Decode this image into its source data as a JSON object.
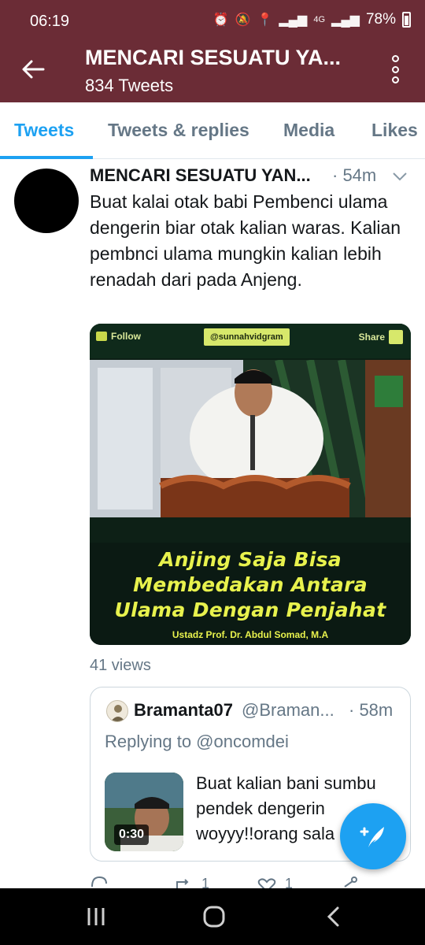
{
  "status_bar": {
    "time": "06:19",
    "network": "4G",
    "battery": "78%"
  },
  "header": {
    "title": "MENCARI SESUATU YA...",
    "tweet_count": "834 Tweets"
  },
  "tabs": [
    {
      "label": "Tweets",
      "active": true
    },
    {
      "label": "Tweets & replies",
      "active": false
    },
    {
      "label": "Media",
      "active": false
    },
    {
      "label": "Likes",
      "active": false
    }
  ],
  "tweet": {
    "name": "MENCARI SESUATU YAN...",
    "time": "· 54m",
    "text": "Buat kalai otak babi Pembenci ulama dengerin  biar otak kalian waras. Kalian pembnci ulama mungkin kalian lebih renadah dari pada Anjeng.",
    "views": "41 views",
    "media": {
      "follow_label": "Follow",
      "handle": "@sunnahvidgram",
      "share_label": "Share",
      "caption_lines": [
        "Anjing Saja Bisa",
        "Membedakan Antara",
        "Ulama Dengan Penjahat"
      ],
      "credit": "Ustadz  Prof. Dr. Abdul Somad, M.A"
    }
  },
  "quoted": {
    "name": "Bramanta07",
    "handle": "@Braman...",
    "time": "· 58m",
    "replying_to": "Replying to @oncomdei",
    "video_duration": "0:30",
    "text": "Buat kalian bani sumbu pendek dengerin woyyy!!orang sala"
  },
  "actions": {
    "retweets": "1",
    "likes": "1"
  },
  "colors": {
    "header_bg": "#6b2c36",
    "accent": "#1da1f2",
    "muted": "#657786"
  }
}
